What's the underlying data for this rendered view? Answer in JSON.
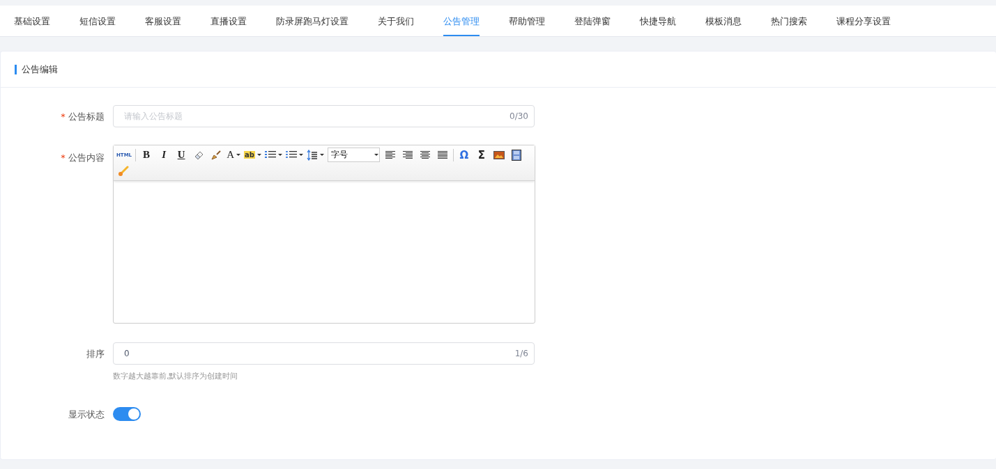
{
  "tabs": [
    {
      "label": "基础设置",
      "selected": false
    },
    {
      "label": "短信设置",
      "selected": false
    },
    {
      "label": "客服设置",
      "selected": false
    },
    {
      "label": "直播设置",
      "selected": false
    },
    {
      "label": "防录屏跑马灯设置",
      "selected": false
    },
    {
      "label": "关于我们",
      "selected": false
    },
    {
      "label": "公告管理",
      "selected": true
    },
    {
      "label": "帮助管理",
      "selected": false
    },
    {
      "label": "登陆弹窗",
      "selected": false
    },
    {
      "label": "快捷导航",
      "selected": false
    },
    {
      "label": "模板消息",
      "selected": false
    },
    {
      "label": "热门搜索",
      "selected": false
    },
    {
      "label": "课程分享设置",
      "selected": false
    }
  ],
  "card": {
    "title": "公告编辑",
    "title_field": {
      "label": "公告标题",
      "required_mark": "*",
      "placeholder": "请输入公告标题",
      "counter": "0/30"
    },
    "content_field": {
      "label": "公告内容",
      "required_mark": "*",
      "toolbar": [
        {
          "kind": "html",
          "label": "HTML"
        },
        {
          "kind": "separator"
        },
        {
          "kind": "bold",
          "label": "B"
        },
        {
          "kind": "italic",
          "label": "I"
        },
        {
          "kind": "underline",
          "label": "U"
        },
        {
          "kind": "eraser"
        },
        {
          "kind": "brush"
        },
        {
          "kind": "font-color",
          "label": "A",
          "dropdown": true
        },
        {
          "kind": "highlight",
          "label": "ab",
          "dropdown": true
        },
        {
          "kind": "ordered-list",
          "dropdown": true
        },
        {
          "kind": "bullet-list",
          "dropdown": true
        },
        {
          "kind": "line-height",
          "dropdown": true
        },
        {
          "kind": "select",
          "label": "字号"
        },
        {
          "kind": "align-left"
        },
        {
          "kind": "align-right"
        },
        {
          "kind": "align-center"
        },
        {
          "kind": "justify"
        },
        {
          "kind": "separator"
        },
        {
          "kind": "omega",
          "label": "Ω"
        },
        {
          "kind": "sigma",
          "label": "Σ"
        },
        {
          "kind": "image"
        },
        {
          "kind": "video"
        },
        {
          "kind": "paint"
        }
      ]
    },
    "sort_field": {
      "label": "排序",
      "value": "0",
      "counter": "1/6",
      "hint": "数字越大越靠前,默认排序为创建时间"
    },
    "status_field": {
      "label": "显示状态",
      "on": true
    }
  }
}
